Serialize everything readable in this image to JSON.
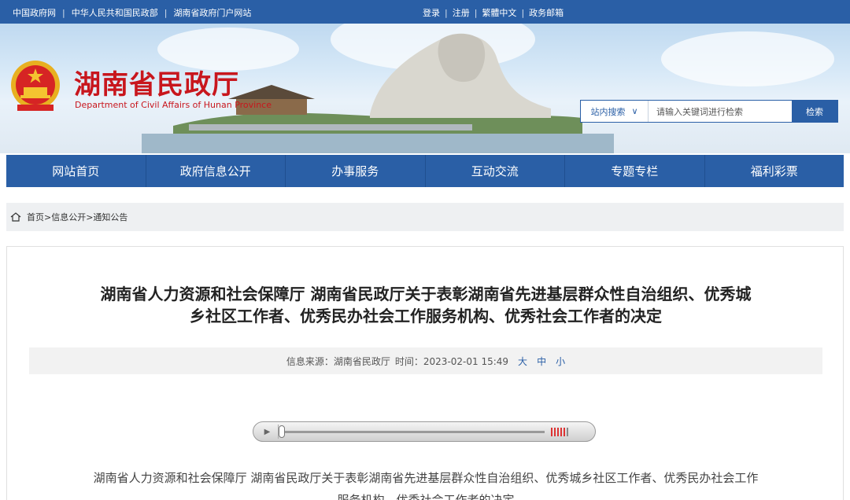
{
  "topbar": {
    "links_left": [
      "中国政府网",
      "中华人民共和国民政部",
      "湖南省政府门户网站"
    ],
    "links_right": [
      "登录",
      "注册",
      "繁體中文",
      "政务邮箱"
    ]
  },
  "header": {
    "title": "湖南省民政厅",
    "subtitle": "Department of Civil Affairs of Hunan Province"
  },
  "search": {
    "scope": "站内搜索",
    "scope_icon": "chevron-down-icon",
    "placeholder": "请输入关键词进行检索",
    "button": "检索"
  },
  "nav": [
    "网站首页",
    "政府信息公开",
    "办事服务",
    "互动交流",
    "专题专栏",
    "福利彩票"
  ],
  "breadcrumb": {
    "icon": "home-icon",
    "path": "首页>信息公开>通知公告"
  },
  "article": {
    "title_line1": "湖南省人力资源和社会保障厅 湖南省民政厅关于表彰湖南省先进基层群众性自治组织、优秀城",
    "title_line2": "乡社区工作者、优秀民办社会工作服务机构、优秀社会工作者的决定",
    "meta_source": "信息来源：湖南省民政厅",
    "meta_time": "时间：2023-02-01 15:49",
    "font_sizes": [
      "大",
      "中",
      "小"
    ],
    "body_line1": "湖南省人力资源和社会保障厅  湖南省民政厅关于表彰湖南省先进基层群众性自治组织、优秀城乡社区工作者、优秀民办社会工作",
    "body_line2": "服务机构、优秀社会工作者的决定"
  },
  "colors": {
    "primary": "#2a5fa6",
    "brand_red": "#c8161d"
  }
}
